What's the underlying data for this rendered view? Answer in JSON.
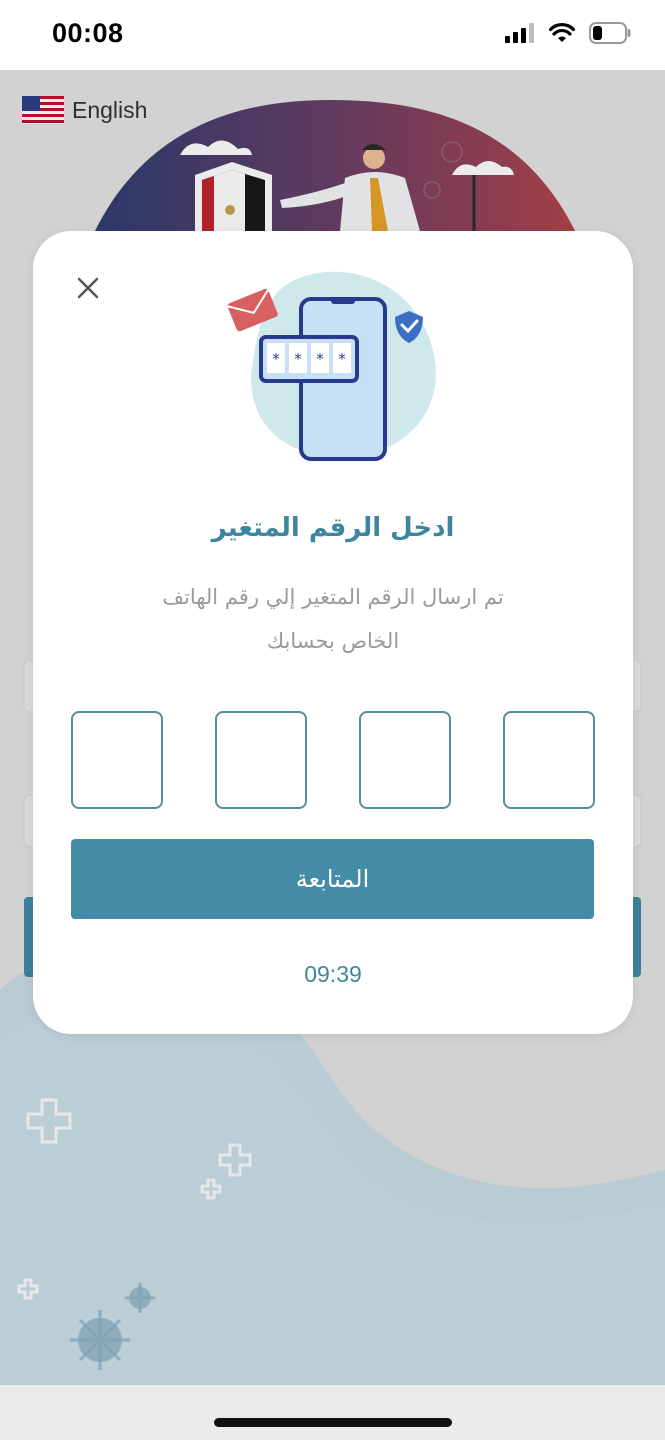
{
  "status_bar": {
    "time": "00:08",
    "icons": [
      "cellular-signal-icon",
      "wifi-icon",
      "battery-icon"
    ]
  },
  "header": {
    "language_label": "English",
    "flag": "us-flag-icon"
  },
  "background": {
    "illustration": "egypt-shield-doctor-illustration",
    "decor_icons": [
      "plus-decor-icon",
      "virus-decor-icon"
    ]
  },
  "modal": {
    "close_icon": "close-icon",
    "illustration": "phone-otp-illustration",
    "title": "ادخل الرقم المتغير",
    "subtitle_line1": "تم ارسال الرقم المتغير إلي رقم الهاتف",
    "subtitle_line2": "الخاص بحسابك",
    "otp": {
      "length": 4,
      "values": [
        "",
        "",
        "",
        ""
      ]
    },
    "continue_label": "المتابعة",
    "timer": "09:39"
  },
  "colors": {
    "accent": "#3e869f",
    "button": "#448ca6",
    "background": "#e4e4e4",
    "blob": "#c9dde5"
  }
}
